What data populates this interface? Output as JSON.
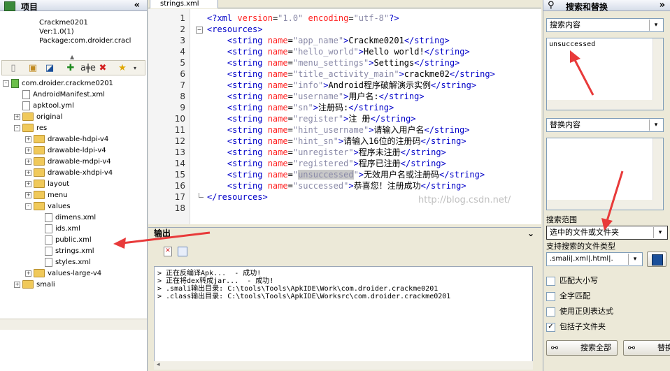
{
  "project_panel": {
    "title": "项目",
    "collapse": "«",
    "app_name": "Crackme0201",
    "version": "Ver:1.0(1)",
    "package": "Package:com.droider.cracl"
  },
  "tree": [
    {
      "label": "com.droider.crackme0201",
      "depth": 0,
      "kind": "root",
      "exp": "-"
    },
    {
      "label": "AndroidManifest.xml",
      "depth": 1,
      "kind": "file"
    },
    {
      "label": "apktool.yml",
      "depth": 1,
      "kind": "file"
    },
    {
      "label": "original",
      "depth": 1,
      "kind": "folder",
      "exp": "+"
    },
    {
      "label": "res",
      "depth": 1,
      "kind": "folder",
      "exp": "-"
    },
    {
      "label": "drawable-hdpi-v4",
      "depth": 2,
      "kind": "folder",
      "exp": "+"
    },
    {
      "label": "drawable-ldpi-v4",
      "depth": 2,
      "kind": "folder",
      "exp": "+"
    },
    {
      "label": "drawable-mdpi-v4",
      "depth": 2,
      "kind": "folder",
      "exp": "+"
    },
    {
      "label": "drawable-xhdpi-v4",
      "depth": 2,
      "kind": "folder",
      "exp": "+"
    },
    {
      "label": "layout",
      "depth": 2,
      "kind": "folder",
      "exp": "+"
    },
    {
      "label": "menu",
      "depth": 2,
      "kind": "folder",
      "exp": "+"
    },
    {
      "label": "values",
      "depth": 2,
      "kind": "folder",
      "exp": "-"
    },
    {
      "label": "dimens.xml",
      "depth": 3,
      "kind": "file"
    },
    {
      "label": "ids.xml",
      "depth": 3,
      "kind": "file"
    },
    {
      "label": "public.xml",
      "depth": 3,
      "kind": "file"
    },
    {
      "label": "strings.xml",
      "depth": 3,
      "kind": "file"
    },
    {
      "label": "styles.xml",
      "depth": 3,
      "kind": "file"
    },
    {
      "label": "values-large-v4",
      "depth": 2,
      "kind": "folder",
      "exp": "+"
    },
    {
      "label": "smali",
      "depth": 1,
      "kind": "folder",
      "exp": "+"
    }
  ],
  "editor": {
    "tab": "strings.xml",
    "watermark": "http://blog.csdn.net/",
    "lines": [
      {
        "n": "1",
        "pi": true,
        "text": "<?xml version=\"1.0\" encoding=\"utf-8\"?>"
      },
      {
        "n": "2",
        "open": "resources"
      },
      {
        "n": "3",
        "name": "app_name",
        "value": "Crackme0201"
      },
      {
        "n": "4",
        "name": "hello_world",
        "value": "Hello world!"
      },
      {
        "n": "5",
        "name": "menu_settings",
        "value": "Settings"
      },
      {
        "n": "6",
        "name": "title_activity_main",
        "value": "crackme02"
      },
      {
        "n": "7",
        "name": "info",
        "value": "Android程序破解演示实例"
      },
      {
        "n": "8",
        "name": "username",
        "value": "用户名:"
      },
      {
        "n": "9",
        "name": "sn",
        "value": "注册码:"
      },
      {
        "n": "10",
        "name": "register",
        "value": "注 册"
      },
      {
        "n": "11",
        "name": "hint_username",
        "value": "请输入用户名"
      },
      {
        "n": "12",
        "name": "hint_sn",
        "value": "请输入16位的注册码"
      },
      {
        "n": "13",
        "name": "unregister",
        "value": "程序未注册"
      },
      {
        "n": "14",
        "name": "registered",
        "value": "程序已注册"
      },
      {
        "n": "15",
        "name": "unsuccessed",
        "value": "无效用户名或注册码",
        "highlight": true
      },
      {
        "n": "16",
        "name": "successed",
        "value": "恭喜您！注册成功"
      },
      {
        "n": "17",
        "close": "resources"
      },
      {
        "n": "18"
      }
    ]
  },
  "output": {
    "title": "输出",
    "lines": [
      "> 正在反编译Apk...  - 成功!",
      "> 正在将dex转成jar...  - 成功!",
      "> .smali输出目录: C:\\tools\\Tools\\ApkIDE\\Work\\com.droider.crackme0201",
      "> .class输出目录: C:\\tools\\Tools\\ApkIDE\\Worksrc\\com.droider.crackme0201"
    ]
  },
  "search": {
    "title": "搜索和替换",
    "search_label": "搜索内容",
    "search_value": "unsuccessed",
    "replace_label": "替换内容",
    "scope_label": "搜索范围",
    "scope_value": "选中的文件或文件夹",
    "types_label": "支持搜索的文件类型",
    "types_value": ".smali|.xml|.html|.",
    "match_case": "匹配大小写",
    "whole_word": "全字匹配",
    "regex": "使用正则表达式",
    "subfolders": "包括子文件夹",
    "search_all": "搜索全部",
    "replace": "替换"
  },
  "colors": {
    "arrow": "#e83a3a",
    "tag": "#0000c8",
    "attr": "#ff2222",
    "value": "#8a8aa8"
  }
}
